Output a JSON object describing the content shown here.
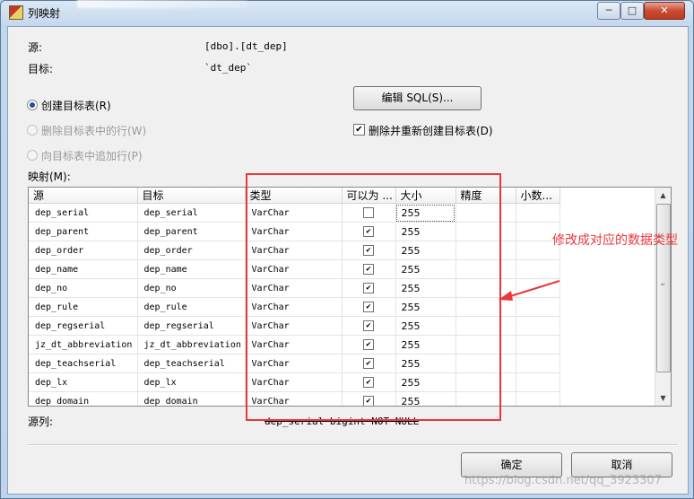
{
  "window": {
    "title": "列映射",
    "controls": {
      "minimize": "─",
      "maximize": "□",
      "close": "✕"
    }
  },
  "source": {
    "label": "源:",
    "value": "[dbo].[dt_dep]"
  },
  "target": {
    "label": "目标:",
    "value": "`dt_dep`"
  },
  "options": {
    "create_table": {
      "label": "创建目标表(R)",
      "selected": true
    },
    "delete_rows": {
      "label": "删除目标表中的行(W)",
      "enabled": false
    },
    "append_rows": {
      "label": "向目标表中追加行(P)",
      "enabled": false
    },
    "edit_sql_button": "编辑 SQL(S)...",
    "drop_recreate": {
      "label": "删除并重新创建目标表(D)",
      "checked": true
    }
  },
  "mapping": {
    "label": "映射(M):",
    "columns": [
      "源",
      "目标",
      "类型",
      "可以为 ...",
      "大小",
      "精度",
      "小数..."
    ],
    "rows": [
      {
        "source": "dep_serial",
        "target": "dep_serial",
        "type": "VarChar",
        "nullable": false,
        "size": "255"
      },
      {
        "source": "dep_parent",
        "target": "dep_parent",
        "type": "VarChar",
        "nullable": true,
        "size": "255"
      },
      {
        "source": "dep_order",
        "target": "dep_order",
        "type": "VarChar",
        "nullable": true,
        "size": "255"
      },
      {
        "source": "dep_name",
        "target": "dep_name",
        "type": "VarChar",
        "nullable": true,
        "size": "255"
      },
      {
        "source": "dep_no",
        "target": "dep_no",
        "type": "VarChar",
        "nullable": true,
        "size": "255"
      },
      {
        "source": "dep_rule",
        "target": "dep_rule",
        "type": "VarChar",
        "nullable": true,
        "size": "255"
      },
      {
        "source": "dep_regserial",
        "target": "dep_regserial",
        "type": "VarChar",
        "nullable": true,
        "size": "255"
      },
      {
        "source": "jz_dt_abbreviation",
        "target": "jz_dt_abbreviation",
        "type": "VarChar",
        "nullable": true,
        "size": "255"
      },
      {
        "source": "dep_teachserial",
        "target": "dep_teachserial",
        "type": "VarChar",
        "nullable": true,
        "size": "255"
      },
      {
        "source": "dep_lx",
        "target": "dep_lx",
        "type": "VarChar",
        "nullable": true,
        "size": "255"
      },
      {
        "source": "dep_domain",
        "target": "dep_domain",
        "type": "VarChar",
        "nullable": true,
        "size": "255"
      }
    ]
  },
  "source_column": {
    "label": "源列:",
    "value": "dep_serial bigint NOT NULL"
  },
  "buttons": {
    "ok": "确定",
    "cancel": "取消"
  },
  "annotation": {
    "text": "修改成对应的数据类型",
    "color": "#e8383a"
  },
  "watermark": "https://blog.csdn.net/qq_3923307"
}
